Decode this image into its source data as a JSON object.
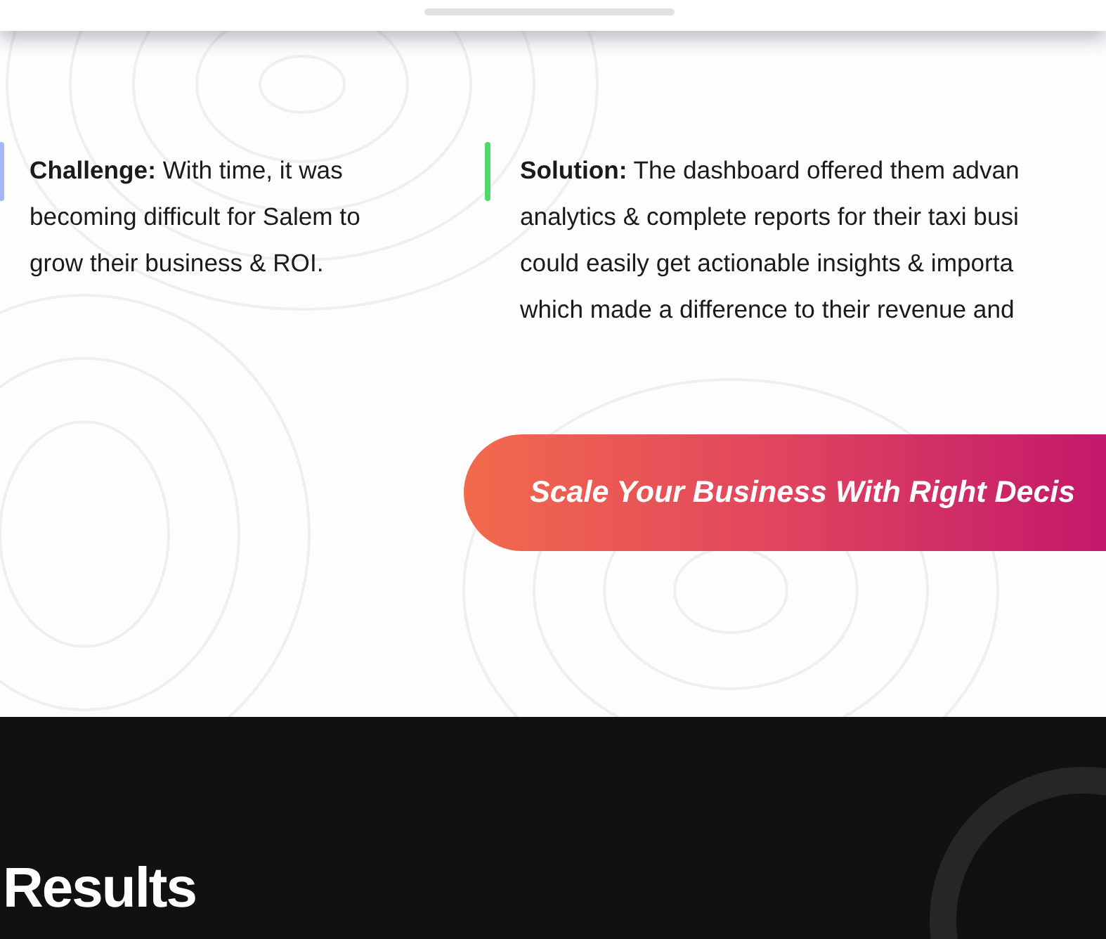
{
  "case_points": [
    {
      "kind": "challenge",
      "color": "#a9b4f7",
      "lines": [
        "**Challenge:** With time, it was",
        "becoming difficult for Salem to",
        "grow their business & ROI."
      ]
    },
    {
      "kind": "solution",
      "color": "#4cd964",
      "lines": [
        "**Solution:** The dashboard offered them advan",
        "analytics & complete reports for their taxi busi",
        "could easily get actionable insights & importa",
        "which made a difference to their revenue and"
      ]
    }
  ],
  "cta_button": {
    "label": "Scale Your Business With Right Decis"
  },
  "results": {
    "title": "Results"
  }
}
